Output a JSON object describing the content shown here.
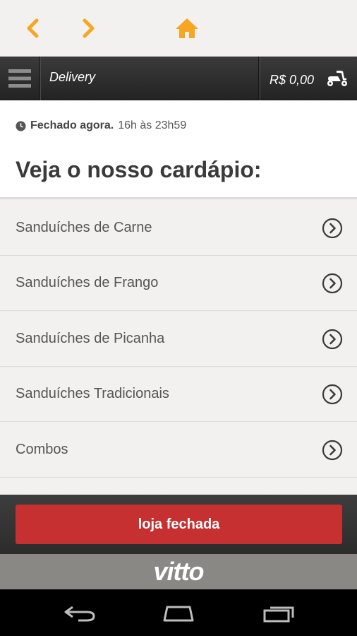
{
  "app": {
    "header_title": "Delivery",
    "cart_total": "R$ 0,00"
  },
  "status": {
    "closed": "Fechado agora.",
    "hours": "16h às 23h59"
  },
  "menu": {
    "title": "Veja o nosso cardápio:",
    "items": [
      {
        "label": "Sanduíches de Carne"
      },
      {
        "label": "Sanduíches de Frango"
      },
      {
        "label": "Sanduíches de Picanha"
      },
      {
        "label": "Sanduíches Tradicionais"
      },
      {
        "label": "Combos"
      }
    ]
  },
  "footer": {
    "button_label": "loja fechada"
  },
  "brand": {
    "logo_text": "vitto"
  },
  "icons": [
    "chevron-left-icon",
    "chevron-right-icon",
    "home-icon",
    "hamburger-menu-icon",
    "scooter-icon",
    "clock-icon",
    "circle-arrow-right-icon",
    "android-back-icon",
    "android-home-icon",
    "android-recents-icon"
  ],
  "colors": {
    "accent_orange": "#f5a623",
    "header_dark": "#2a2a2a",
    "closed_red": "#c73030",
    "brand_gray": "#8a8885"
  }
}
